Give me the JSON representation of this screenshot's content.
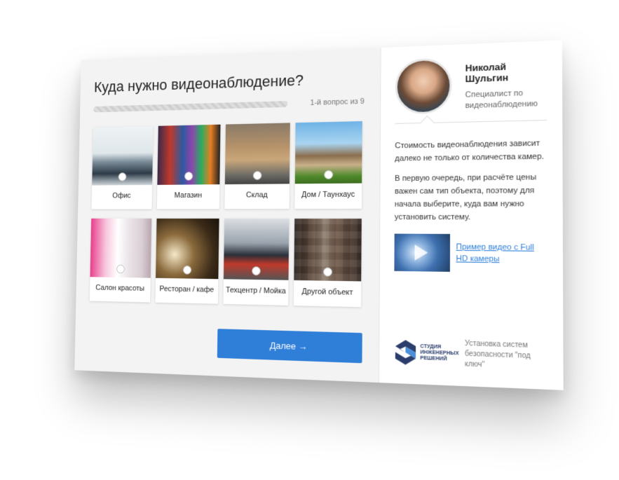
{
  "quiz": {
    "title": "Куда нужно видеонаблюдение?",
    "step": "1-й вопрос из 9",
    "next_label": "Далее →",
    "options": [
      {
        "label": "Офис",
        "icon": "office-photo"
      },
      {
        "label": "Магазин",
        "icon": "shop-photo"
      },
      {
        "label": "Склад",
        "icon": "warehouse-photo"
      },
      {
        "label": "Дом / Таунхаус",
        "icon": "house-photo"
      },
      {
        "label": "Салон красоты",
        "icon": "salon-photo"
      },
      {
        "label": "Ресторан / кафе",
        "icon": "restaurant-photo"
      },
      {
        "label": "Техцентр / Мойка",
        "icon": "car-service-photo"
      },
      {
        "label": "Другой объект",
        "icon": "other-object-photo"
      }
    ]
  },
  "expert": {
    "name": "Николай Шульгин",
    "role": "Специалист по видеонаблюдению",
    "paragraph_1": "Стоимость видеонаблюдения зависит далеко не только от количества камер.",
    "paragraph_2": "В первую очередь, при расчёте цены важен сам тип объекта, поэтому для начала выберите, куда вам нужно установить систему.",
    "video_link": "Пример видео с Full HD камеры"
  },
  "footer": {
    "logo_text": "СТУДИЯ ИНЖЕНЕРНЫХ РЕШЕНИЙ",
    "note": "Установка систем безопасности \"под ключ\""
  },
  "colors": {
    "accent": "#2f7fd9",
    "panel_bg": "#f3f3f3",
    "logo_blue": "#2a3d6b"
  }
}
